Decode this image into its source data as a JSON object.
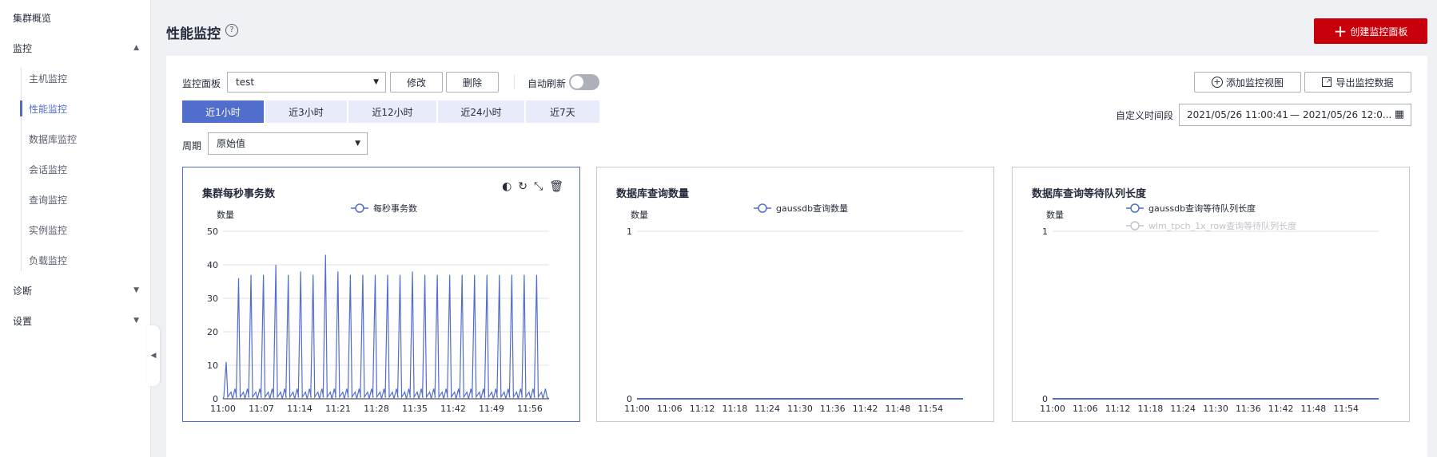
{
  "sidebar": {
    "overview": "集群概览",
    "monitor": "监控",
    "monitor_items": [
      "主机监控",
      "性能监控",
      "数据库监控",
      "会话监控",
      "查询监控",
      "实例监控",
      "负载监控"
    ],
    "diagnose": "诊断",
    "settings": "设置"
  },
  "header": {
    "title": "性能监控",
    "create_button": "创建监控面板"
  },
  "toolbar": {
    "panel_label": "监控面板",
    "panel_value": "test",
    "edit_button": "修改",
    "delete_button": "删除",
    "auto_refresh_label": "自动刷新",
    "add_view_button": "添加监控视图",
    "export_button": "导出监控数据",
    "time_tabs": [
      "近1小时",
      "近3小时",
      "近12小时",
      "近24小时",
      "近7天"
    ],
    "custom_time_label": "自定义时间段",
    "date_start": "2021/05/26 11:00:41",
    "date_sep": "—",
    "date_end": "2021/05/26 12:0...",
    "period_label": "周期",
    "period_value": "原始值"
  },
  "colors": {
    "accent": "#526ecc",
    "danger": "#c7000b",
    "muted_series": "#c0c3ca"
  },
  "chart_data": [
    {
      "type": "line",
      "title": "集群每秒事务数",
      "ylabel": "数量",
      "ylim": [
        0,
        50
      ],
      "yticks": [
        0,
        10,
        20,
        30,
        40,
        50
      ],
      "xticks": [
        "11:00",
        "11:07",
        "11:14",
        "11:21",
        "11:28",
        "11:35",
        "11:42",
        "11:49",
        "11:56"
      ],
      "series": [
        {
          "name": "每秒事务数",
          "color": "#526ecc",
          "peaks": [
            11,
            36,
            37,
            37,
            40,
            37,
            38,
            37,
            43,
            38,
            37,
            37,
            37,
            37,
            37,
            38,
            37,
            37,
            37,
            37,
            37,
            37,
            37,
            37,
            37,
            37
          ]
        }
      ]
    },
    {
      "type": "line",
      "title": "数据库查询数量",
      "ylabel": "数量",
      "ylim": [
        0,
        1
      ],
      "yticks": [
        0,
        1
      ],
      "xticks": [
        "11:00",
        "11:06",
        "11:12",
        "11:18",
        "11:24",
        "11:30",
        "11:36",
        "11:42",
        "11:48",
        "11:54"
      ],
      "series": [
        {
          "name": "gaussdb查询数量",
          "color": "#526ecc",
          "values": [
            0,
            0
          ]
        }
      ]
    },
    {
      "type": "line",
      "title": "数据库查询等待队列长度",
      "ylabel": "数量",
      "ylim": [
        0,
        1
      ],
      "yticks": [
        0,
        1
      ],
      "xticks": [
        "11:00",
        "11:06",
        "11:12",
        "11:18",
        "11:24",
        "11:30",
        "11:36",
        "11:42",
        "11:48",
        "11:54"
      ],
      "series": [
        {
          "name": "gaussdb查询等待队列长度",
          "color": "#526ecc",
          "values": [
            0,
            0
          ]
        },
        {
          "name": "wlm_tpch_1x_row查询等待队列长度",
          "color": "#c0c3ca",
          "muted": true,
          "values": [
            0,
            0
          ]
        }
      ]
    }
  ]
}
